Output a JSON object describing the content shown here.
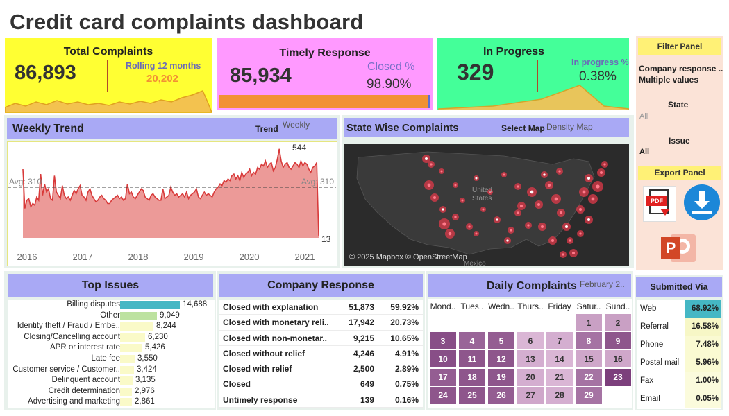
{
  "title": "Credit card complaints dashboard",
  "kpis": {
    "total": {
      "label": "Total Complaints",
      "value": "86,893",
      "sub_label": "Rolling 12 months",
      "sub_value": "20,202"
    },
    "timely": {
      "label": "Timely Response",
      "value": "85,934",
      "sub_label": "Closed %",
      "sub_value": "98.90%",
      "progress": 0.989
    },
    "progress": {
      "label": "In Progress",
      "value": "329",
      "sub_label": "In progress %",
      "sub_value": "0.38%"
    }
  },
  "weekly_trend": {
    "title": "Weekly Trend",
    "control_label": "Trend",
    "control_value": "Weekly",
    "avg_left": "Avg: 310",
    "avg_right": "Avg: 310",
    "max_label": "544",
    "min_label": "13",
    "years": [
      "2016",
      "2017",
      "2018",
      "2019",
      "2020",
      "2021"
    ]
  },
  "chart_data": {
    "type": "area",
    "title": "Weekly Trend",
    "x_ticks": [
      "2016",
      "2017",
      "2018",
      "2019",
      "2020",
      "2021"
    ],
    "reference_line": 310,
    "max": 544,
    "min": 13,
    "values": [
      420,
      180,
      230,
      240,
      190,
      210,
      200,
      250,
      230,
      390,
      260,
      330,
      280,
      300,
      240,
      230,
      380,
      280,
      260,
      240,
      320,
      260,
      240,
      250,
      230,
      260,
      290,
      270,
      300,
      320,
      260,
      250,
      230,
      280,
      300,
      260,
      240,
      220,
      230,
      250,
      260,
      240,
      230,
      210,
      210,
      230,
      240,
      250,
      260,
      240,
      250,
      230,
      240,
      330,
      270,
      280,
      250,
      240,
      260,
      280,
      300,
      290,
      250,
      240,
      230,
      260,
      270,
      250,
      240,
      230,
      230,
      300,
      240,
      250,
      260,
      310,
      280,
      260,
      270,
      250,
      260,
      270,
      250,
      280,
      240,
      260,
      270,
      280,
      300,
      250,
      240,
      260,
      280,
      260,
      270,
      260,
      250,
      280,
      300,
      310,
      330,
      320,
      350,
      340,
      360,
      350,
      380,
      390,
      360,
      380,
      350,
      400,
      370,
      390,
      400,
      420,
      380,
      400,
      390,
      430,
      420,
      450,
      440,
      470,
      430,
      450,
      460,
      410,
      430,
      480,
      544,
      470,
      430,
      450,
      460,
      430,
      420,
      440,
      460,
      450,
      430,
      470,
      440,
      460,
      450,
      420,
      400,
      430,
      440,
      460,
      13
    ]
  },
  "state_map": {
    "title": "State Wise Complaints",
    "control_label": "Select Map",
    "control_value": "Density Map",
    "center_label": "United States",
    "bottom_label": "Mexico",
    "attribution": "© 2025 Mapbox © OpenStreetMap"
  },
  "filter_panel": {
    "title": "Filter Panel",
    "company_label": "Company response ..",
    "company_value": "Multiple values",
    "state_label": "State",
    "state_value": "All",
    "issue_label": "Issue",
    "issue_value": "All"
  },
  "export_panel": {
    "title": "Export Panel",
    "pdf_icon": "pdf-file-icon",
    "download_icon": "download-icon",
    "ppt_icon": "powerpoint-icon",
    "pdf_text": "PDF",
    "ppt_letter": "P"
  },
  "top_issues": {
    "title": "Top Issues",
    "bar_colors": {
      "first": "#45b7c4",
      "second": "#bde2a0",
      "rest": "#fafac8"
    },
    "items": [
      {
        "label": "Billing disputes",
        "value": "14,688",
        "n": 14688
      },
      {
        "label": "Other",
        "value": "9,049",
        "n": 9049
      },
      {
        "label": "Identity theft / Fraud / Embe..",
        "value": "8,244",
        "n": 8244
      },
      {
        "label": "Closing/Cancelling account",
        "value": "6,230",
        "n": 6230
      },
      {
        "label": "APR or interest rate",
        "value": "5,426",
        "n": 5426
      },
      {
        "label": "Late fee",
        "value": "3,550",
        "n": 3550
      },
      {
        "label": "Customer service / Customer..",
        "value": "3,424",
        "n": 3424
      },
      {
        "label": "Delinquent account",
        "value": "3,135",
        "n": 3135
      },
      {
        "label": "Credit determination",
        "value": "2,976",
        "n": 2976
      },
      {
        "label": "Advertising and marketing",
        "value": "2,861",
        "n": 2861
      }
    ]
  },
  "company_response": {
    "title": "Company Response",
    "rows": [
      {
        "label": "Closed with explanation",
        "count": "51,873",
        "pct": "59.92%"
      },
      {
        "label": "Closed with monetary reli..",
        "count": "17,942",
        "pct": "20.73%"
      },
      {
        "label": "Closed with non-monetar..",
        "count": "9,215",
        "pct": "10.65%"
      },
      {
        "label": "Closed without relief",
        "count": "4,246",
        "pct": "4.91%"
      },
      {
        "label": "Closed with relief",
        "count": "2,500",
        "pct": "2.89%"
      },
      {
        "label": "Closed",
        "count": "649",
        "pct": "0.75%"
      },
      {
        "label": "Untimely response",
        "count": "139",
        "pct": "0.16%"
      }
    ]
  },
  "daily_complaints": {
    "title": "Daily Complaints",
    "month": "February 2..",
    "weekdays": [
      "Mond..",
      "Tues..",
      "Wedn..",
      "Thurs..",
      "Friday",
      "Satur..",
      "Sund.."
    ],
    "days": [
      {
        "day": "1",
        "level": 0.3
      },
      {
        "day": "2",
        "level": 0.3
      },
      {
        "day": "3",
        "level": 0.85
      },
      {
        "day": "4",
        "level": 0.7
      },
      {
        "day": "5",
        "level": 0.75
      },
      {
        "day": "6",
        "level": 0.15
      },
      {
        "day": "7",
        "level": 0.2
      },
      {
        "day": "8",
        "level": 0.6
      },
      {
        "day": "9",
        "level": 0.8
      },
      {
        "day": "10",
        "level": 0.85
      },
      {
        "day": "11",
        "level": 0.8
      },
      {
        "day": "12",
        "level": 0.8
      },
      {
        "day": "13",
        "level": 0.2
      },
      {
        "day": "14",
        "level": 0.15
      },
      {
        "day": "15",
        "level": 0.25
      },
      {
        "day": "16",
        "level": 0.25
      },
      {
        "day": "17",
        "level": 0.75
      },
      {
        "day": "18",
        "level": 0.8
      },
      {
        "day": "19",
        "level": 0.8
      },
      {
        "day": "20",
        "level": 0.2
      },
      {
        "day": "21",
        "level": 0.15
      },
      {
        "day": "22",
        "level": 0.6
      },
      {
        "day": "23",
        "level": 0.95
      },
      {
        "day": "24",
        "level": 0.8
      },
      {
        "day": "25",
        "level": 0.8
      },
      {
        "day": "26",
        "level": 0.75
      },
      {
        "day": "27",
        "level": 0.25
      },
      {
        "day": "28",
        "level": 0.2
      },
      {
        "day": "29",
        "level": 0.6
      }
    ]
  },
  "submitted_via": {
    "title": "Submitted Via",
    "rows": [
      {
        "label": "Web",
        "pct": "68.92%"
      },
      {
        "label": "Referral",
        "pct": "16.58%"
      },
      {
        "label": "Phone",
        "pct": "7.48%"
      },
      {
        "label": "Postal mail",
        "pct": "5.96%"
      },
      {
        "label": "Fax",
        "pct": "1.00%"
      },
      {
        "label": "Email",
        "pct": "0.05%"
      }
    ]
  },
  "colors": {
    "total_card": "#ffff33",
    "timely_card": "#ff99ff",
    "progress_card": "#44ff99",
    "panel_header": "#a9a9f5",
    "sidebar_bg": "#fbe3d7",
    "sidebar_head": "#fff176",
    "trend_fill": "#ec9a98",
    "trend_line": "#d83a3a",
    "orange": "#f29134"
  }
}
